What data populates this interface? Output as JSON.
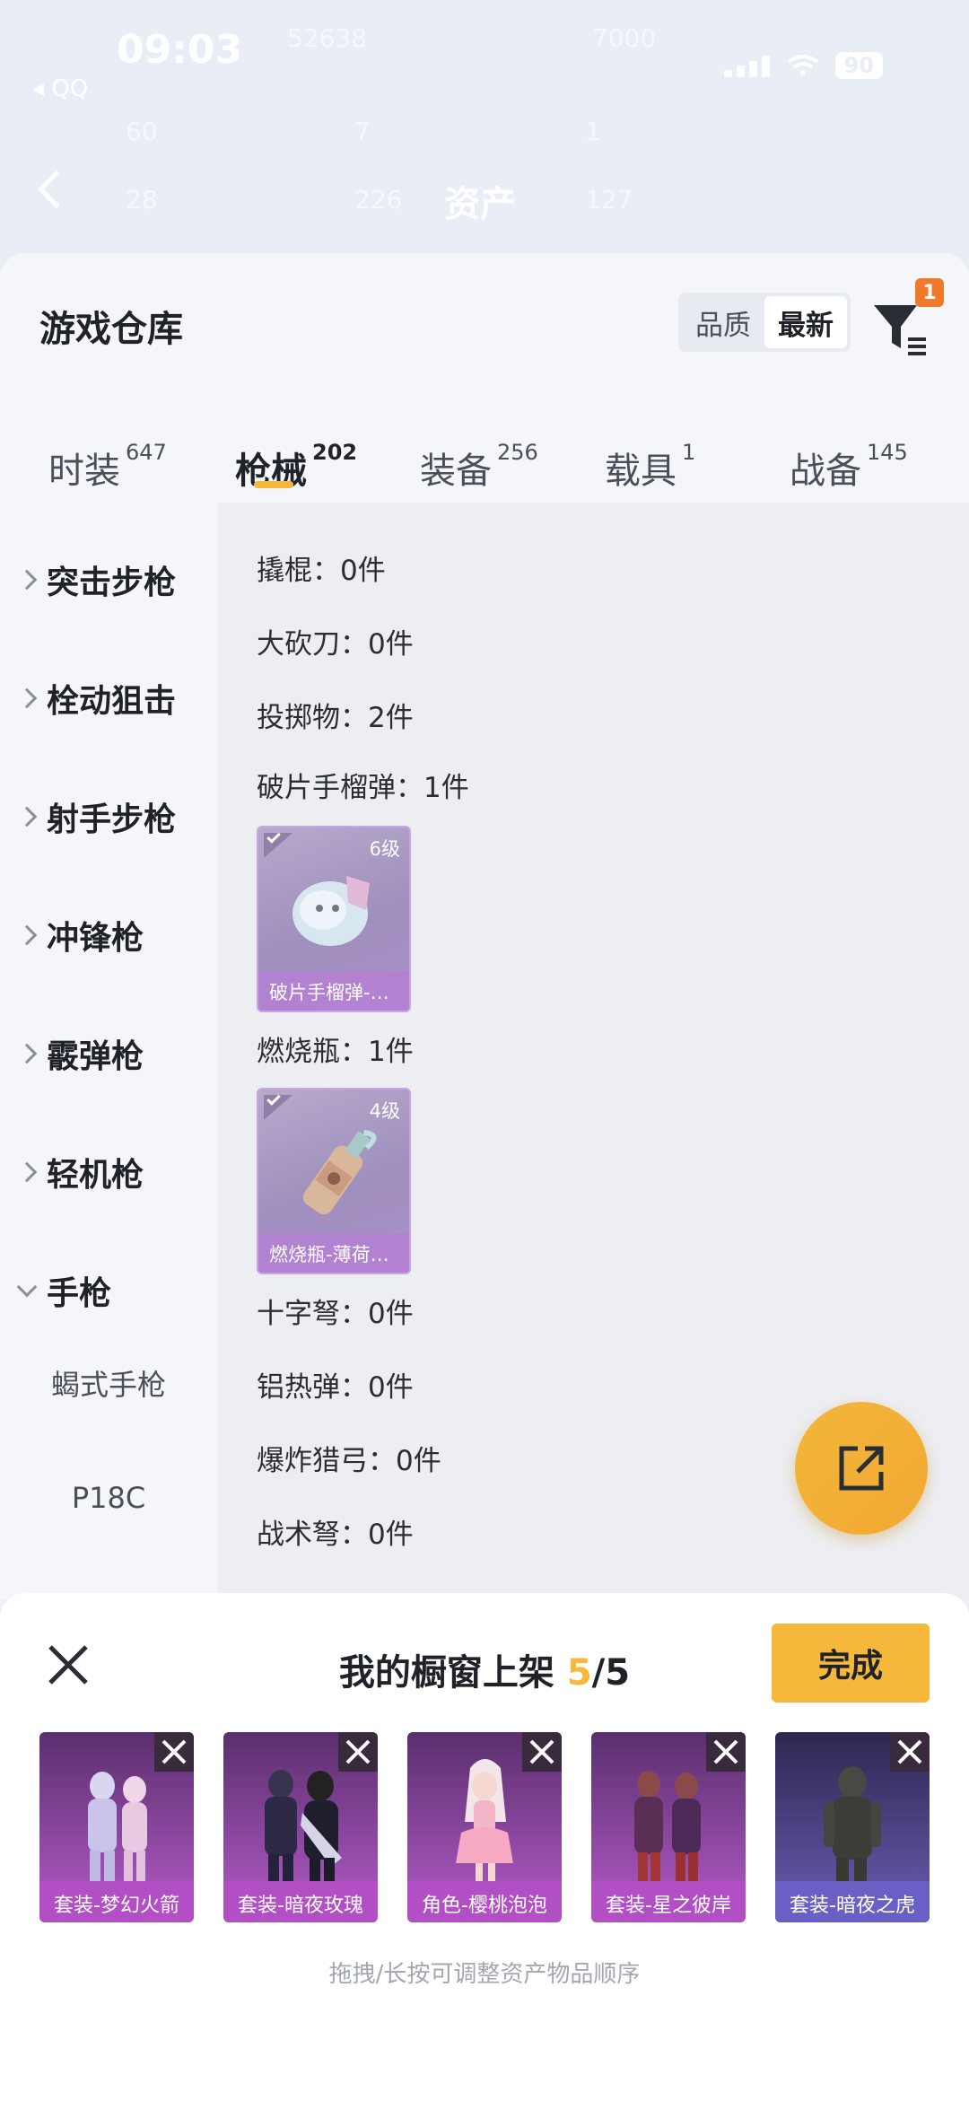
{
  "status_bar": {
    "time": "09:03",
    "back_app": "◂ QQ",
    "battery": "90"
  },
  "background_page": {
    "title": "资产",
    "faint_values": [
      "52638",
      "7000",
      "60",
      "7",
      "1",
      "28",
      "226",
      "127"
    ]
  },
  "sheet": {
    "title": "游戏仓库",
    "sort_options": [
      "品质",
      "最新"
    ],
    "sort_selected": "最新",
    "filter_badge": "1",
    "tabs": [
      {
        "label": "时装",
        "count": "647"
      },
      {
        "label": "枪械",
        "count": "202"
      },
      {
        "label": "装备",
        "count": "256"
      },
      {
        "label": "载具",
        "count": "1"
      },
      {
        "label": "战备",
        "count": "145"
      }
    ],
    "active_tab": "枪械",
    "categories": [
      {
        "label": "突击步枪",
        "expanded": false
      },
      {
        "label": "栓动狙击",
        "expanded": false
      },
      {
        "label": "射手步枪",
        "expanded": false
      },
      {
        "label": "冲锋枪",
        "expanded": false
      },
      {
        "label": "霰弹枪",
        "expanded": false
      },
      {
        "label": "轻机枪",
        "expanded": false
      },
      {
        "label": "手枪",
        "expanded": true
      }
    ],
    "subcategories": [
      "蝎式手枪",
      "P18C"
    ],
    "content_rows": [
      "撬棍：0件",
      "大砍刀：0件",
      "投掷物：2件",
      "破片手榴弹：1件",
      "燃烧瓶：1件",
      "十字弩：0件",
      "铝热弹：0件",
      "爆炸猎弓：0件",
      "战术弩：0件"
    ],
    "items": [
      {
        "level": "6级",
        "name": "破片手榴弹-…"
      },
      {
        "level": "4级",
        "name": "燃烧瓶-薄荷…"
      }
    ]
  },
  "shelf": {
    "title_prefix": "我的橱窗上架 ",
    "count_current": "5",
    "count_total": "/5",
    "done_label": "完成",
    "items": [
      {
        "caption": "套装-梦幻火箭"
      },
      {
        "caption": "套装-暗夜玫瑰"
      },
      {
        "caption": "角色-樱桃泡泡"
      },
      {
        "caption": "套装-星之彼岸"
      },
      {
        "caption": "套装-暗夜之虎"
      }
    ],
    "hint": "拖拽/长按可调整资产物品顺序"
  },
  "colors": {
    "accent": "#f5b83a",
    "badge": "#f07a2a",
    "item_purple": "#a98fc7"
  }
}
